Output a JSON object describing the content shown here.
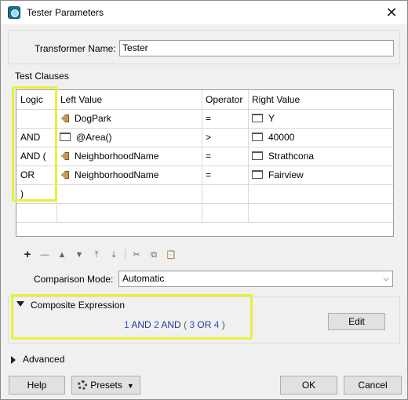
{
  "window": {
    "title": "Tester Parameters",
    "close_glyph": "✕"
  },
  "transformer_name": {
    "label": "Transformer Name:",
    "value": "Tester"
  },
  "test_clauses": {
    "label": "Test Clauses",
    "headers": {
      "logic": "Logic",
      "left": "Left Value",
      "operator": "Operator",
      "right": "Right Value"
    },
    "rows": [
      {
        "logic": "",
        "left": "DogPark",
        "left_icon": "attribute-icon",
        "operator": "=",
        "right": "Y",
        "right_icon": "value-icon"
      },
      {
        "logic": "AND",
        "left": "@Area()",
        "left_icon": "value-icon",
        "operator": ">",
        "right": "40000",
        "right_icon": "value-icon"
      },
      {
        "logic": "AND (",
        "left": "NeighborhoodName",
        "left_icon": "attribute-icon",
        "operator": "=",
        "right": "Strathcona",
        "right_icon": "value-icon"
      },
      {
        "logic": "OR",
        "left": "NeighborhoodName",
        "left_icon": "attribute-icon",
        "operator": "=",
        "right": "Fairview",
        "right_icon": "value-icon"
      },
      {
        "logic": ")",
        "left": "",
        "operator": "",
        "right": ""
      },
      {
        "logic": "",
        "left": "",
        "operator": "",
        "right": ""
      }
    ]
  },
  "toolbar": {
    "add": "+",
    "remove": "—",
    "move_up": "▲",
    "move_down": "▼",
    "move_top": "⤒",
    "move_bottom": "⤓",
    "cut": "✂",
    "copy": "⧉",
    "paste": "📋"
  },
  "comparison_mode": {
    "label": "Comparison Mode:",
    "value": "Automatic"
  },
  "composite_expression": {
    "label": "Composite Expression",
    "expression": [
      {
        "t": "1",
        "k": "num"
      },
      {
        "t": " AND ",
        "k": "kw"
      },
      {
        "t": "2",
        "k": "num"
      },
      {
        "t": " AND ",
        "k": "kw"
      },
      {
        "t": "( ",
        "k": "paren"
      },
      {
        "t": "3",
        "k": "num"
      },
      {
        "t": " OR ",
        "k": "kw"
      },
      {
        "t": "4",
        "k": "num"
      },
      {
        "t": " )",
        "k": "paren"
      }
    ],
    "edit_button": "Edit"
  },
  "advanced": {
    "label": "Advanced"
  },
  "footer": {
    "help": "Help",
    "presets": "Presets",
    "ok": "OK",
    "cancel": "Cancel"
  },
  "colors": {
    "highlight": "#e5f23a",
    "expr_number": "#2d55c9",
    "expr_keyword": "#253a96"
  }
}
